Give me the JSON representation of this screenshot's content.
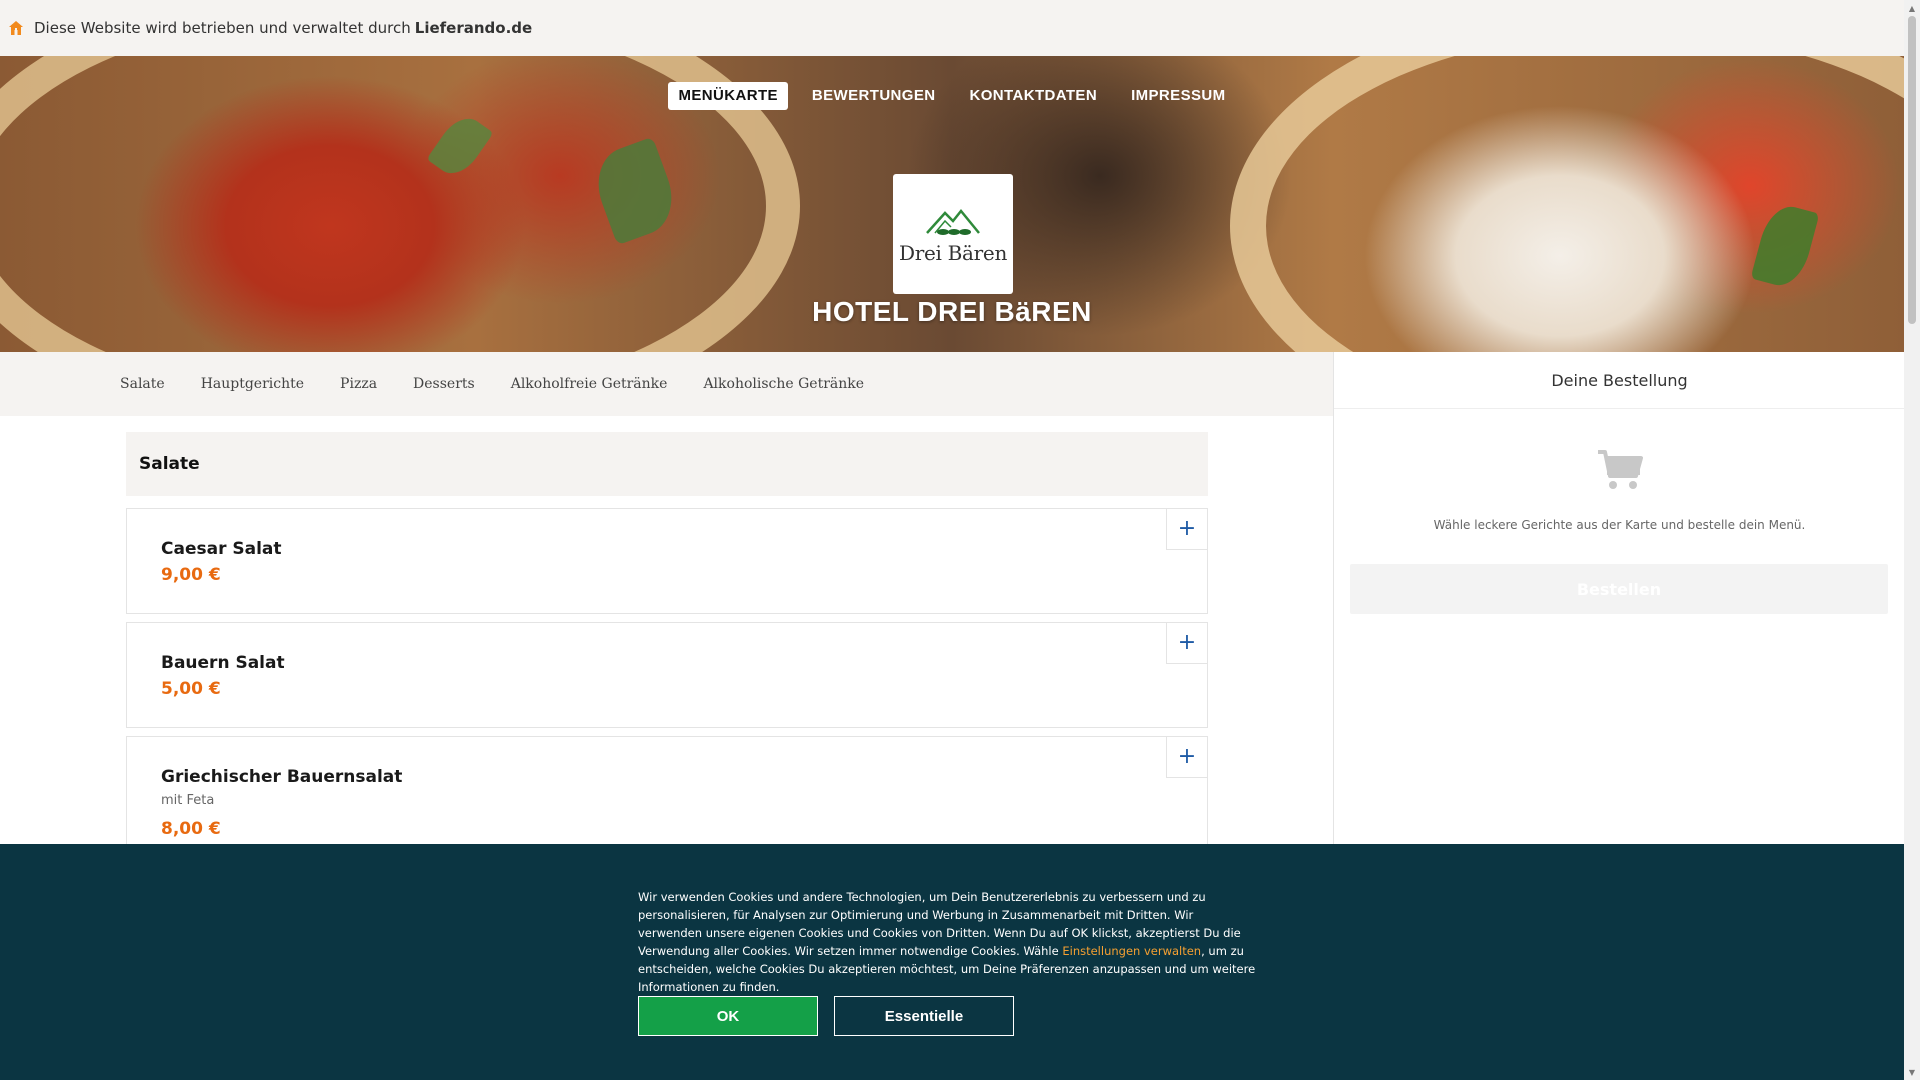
{
  "notice": {
    "prefix": "Diese Website wird betrieben und verwaltet durch",
    "brand": "Lieferando.de",
    "icon": "home-icon"
  },
  "nav": {
    "items": [
      {
        "label": "MENÜKARTE",
        "active": true
      },
      {
        "label": "BEWERTUNGEN",
        "active": false
      },
      {
        "label": "KONTAKTDATEN",
        "active": false
      },
      {
        "label": "IMPRESSUM",
        "active": false
      }
    ]
  },
  "restaurant": {
    "logo_text": "Drei Bären",
    "title": "HOTEL DREI BäREN"
  },
  "categories": [
    "Salate",
    "Hauptgerichte",
    "Pizza",
    "Desserts",
    "Alkoholfreie Getränke",
    "Alkoholische Getränke"
  ],
  "menu": {
    "section_title": "Salate",
    "items": [
      {
        "name": "Caesar Salat",
        "description": "",
        "price": "9,00 €"
      },
      {
        "name": "Bauern Salat",
        "description": "",
        "price": "5,00 €"
      },
      {
        "name": "Griechischer Bauernsalat",
        "description": "mit Feta",
        "price": "8,00 €"
      }
    ],
    "add_label": "+"
  },
  "order": {
    "title": "Deine Bestellung",
    "hint": "Wähle leckere Gerichte aus der Karte und bestelle dein Menü.",
    "button": "Bestellen",
    "icon": "shopping-cart-icon"
  },
  "cookie": {
    "text_before": "Wir verwenden Cookies und andere Technologien, um Dein Benutzererlebnis zu verbessern und zu personalisieren, für Analysen zur Optimierung und Werbung in Zusammenarbeit mit Dritten. Wir verwenden unsere eigenen Cookies und Cookies von Dritten. Wenn Du auf OK klickst, akzeptierst Du die Verwendung aller Cookies. Wir setzen immer notwendige Cookies. Wähle ",
    "link": "Einstellungen verwalten",
    "text_after": ", um zu entscheiden, welche Cookies Du akzeptieren möchtest, um Deine Präferenzen anzupassen und um weitere Informationen zu finden.",
    "ok": "OK",
    "essential": "Essentielle"
  },
  "colors": {
    "accent_orange": "#e86a10",
    "cookie_bg": "#0b3542",
    "ok_green": "#14a048",
    "add_blue": "#1e5aa5"
  }
}
